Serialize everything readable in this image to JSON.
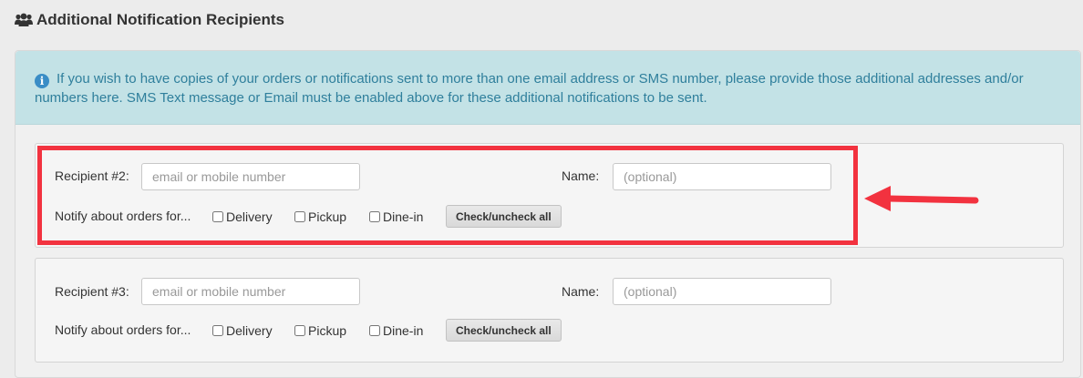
{
  "section": {
    "title": "Additional Notification Recipients",
    "icon": "users-icon"
  },
  "info": {
    "icon": "info-circle-icon",
    "text": "If you wish to have copies of your orders or notifications sent to more than one email address or SMS number, please provide those additional addresses and/or numbers here. SMS Text message or Email must be enabled above for these additional notifications to be sent."
  },
  "recipients": [
    {
      "label": "Recipient #2:",
      "contact_value": "",
      "contact_placeholder": "email or mobile number",
      "name_label": "Name:",
      "name_value": "",
      "name_placeholder": "(optional)",
      "notify_label": "Notify about orders for...",
      "options": [
        {
          "label": "Delivery",
          "checked": false
        },
        {
          "label": "Pickup",
          "checked": false
        },
        {
          "label": "Dine-in",
          "checked": false
        }
      ],
      "toggle_label": "Check/uncheck all"
    },
    {
      "label": "Recipient #3:",
      "contact_value": "",
      "contact_placeholder": "email or mobile number",
      "name_label": "Name:",
      "name_value": "",
      "name_placeholder": "(optional)",
      "notify_label": "Notify about orders for...",
      "options": [
        {
          "label": "Delivery",
          "checked": false
        },
        {
          "label": "Pickup",
          "checked": false
        },
        {
          "label": "Dine-in",
          "checked": false
        }
      ],
      "toggle_label": "Check/uncheck all"
    }
  ],
  "annotation": {
    "highlight_color": "#f2323f",
    "highlights": "recipients.0"
  }
}
